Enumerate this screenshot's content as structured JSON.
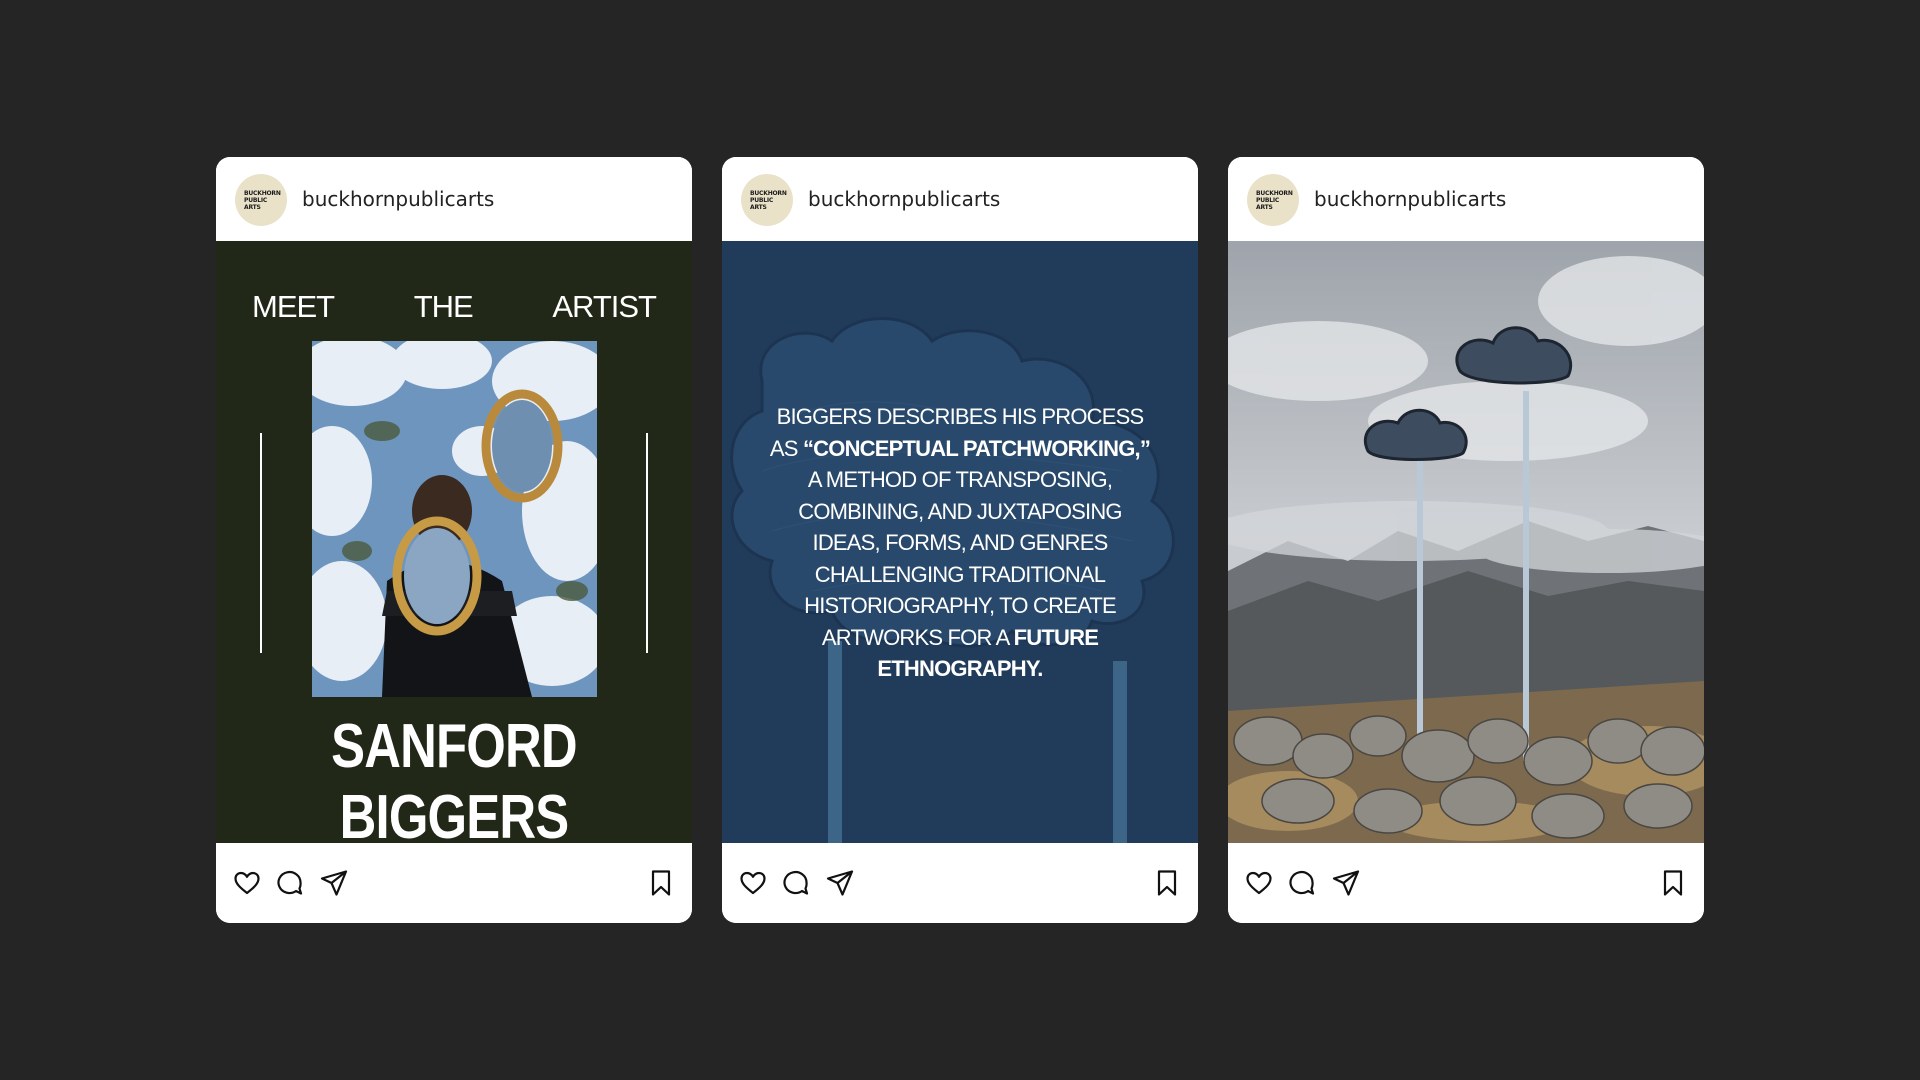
{
  "colors": {
    "page_background": "#252525",
    "card_background": "#ffffff",
    "post1_background": "#222817",
    "post2_background": "#23405f",
    "avatar_background": "#e9e2c9"
  },
  "posts": [
    {
      "username": "buckhornpublicarts",
      "avatar_text": "BUCKHORN\nPUBLIC\nARTS",
      "meet": "MEET",
      "the": "THE",
      "artist": "ARTIST",
      "artist_name": "SANFORD BIGGERS",
      "actions": [
        "heart-icon",
        "comment-icon",
        "send-icon",
        "bookmark-icon"
      ]
    },
    {
      "username": "buckhornpublicarts",
      "avatar_text": "BUCKHORN\nPUBLIC\nARTS",
      "quote": {
        "part1": "BIGGERS DESCRIBES HIS PROCESS AS ",
        "bold1": "“CONCEPTUAL PATCHWORKING,”",
        "part2": " A METHOD OF TRANSPOSING, COMBINING, AND JUXTAPOSING IDEAS, FORMS, AND GENRES CHALLENGING TRADITIONAL HISTORIOGRAPHY, TO CREATE ARTWORKS FOR A ",
        "bold2": "FUTURE ETHNOGRAPHY."
      },
      "actions": [
        "heart-icon",
        "comment-icon",
        "send-icon",
        "bookmark-icon"
      ]
    },
    {
      "username": "buckhornpublicarts",
      "avatar_text": "BUCKHORN\nPUBLIC\nARTS",
      "actions": [
        "heart-icon",
        "comment-icon",
        "send-icon",
        "bookmark-icon"
      ]
    }
  ]
}
